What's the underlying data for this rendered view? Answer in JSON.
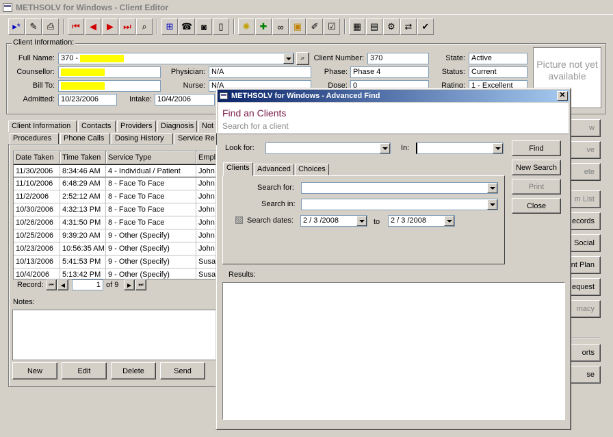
{
  "window": {
    "title": "METHSOLV for Windows - Client Editor"
  },
  "toolbar": {
    "icons": [
      "new-record-icon",
      "edit-icon",
      "print-icon",
      "first-record-icon",
      "previous-record-icon",
      "next-record-icon",
      "last-record-icon",
      "find-icon",
      "add-icon",
      "phone-icon",
      "camera-icon",
      "document-icon",
      "star-icon",
      "add-green-icon",
      "glasses-icon",
      "certificate-icon",
      "note-icon",
      "checklist-icon",
      "calendar-icon",
      "card-icon",
      "settings-icon",
      "transfer-icon",
      "user-check-icon"
    ]
  },
  "client_info": {
    "legend": "Client Information:",
    "full_name_label": "Full Name:",
    "full_name_value": "370 -",
    "counsellor_label": "Counsellor:",
    "bill_to_label": "Bill To:",
    "admitted_label": "Admitted:",
    "admitted_value": "10/23/2006",
    "intake_label": "Intake:",
    "intake_value": "10/4/2006",
    "physician_label": "Physician:",
    "physician_value": "N/A",
    "nurse_label": "Nurse:",
    "nurse_value": "N/A",
    "client_number_label": "Client Number:",
    "client_number_value": "370",
    "phase_label": "Phase:",
    "phase_value": "Phase 4",
    "dose_label": "Dose:",
    "dose_value": "0",
    "state_label": "State:",
    "state_value": "Active",
    "status_label": "Status:",
    "status_value": "Current",
    "rating_label": "Rating:",
    "rating_value": "1 - Excellent",
    "picture_text": "Picture not yet available"
  },
  "tabs_row1": [
    "Client Information",
    "Contacts",
    "Providers",
    "Diagnosis",
    "Not"
  ],
  "tabs_row2": [
    "Procedures",
    "Phone Calls",
    "Dosing History",
    "Service Re"
  ],
  "table": {
    "headers": [
      "Date Taken",
      "Time Taken",
      "Service Type",
      "Empl"
    ],
    "rows": [
      [
        "11/30/2006",
        "8:34:46 AM",
        "4 - Individual / Patient",
        "John"
      ],
      [
        "11/10/2006",
        "6:48:29 AM",
        "8 - Face To Face",
        "John"
      ],
      [
        "11/2/2006",
        "2:52:12 AM",
        "8 - Face To Face",
        "John"
      ],
      [
        "10/30/2006",
        "4:32:13 PM",
        "8 - Face To Face",
        "John"
      ],
      [
        "10/26/2006",
        "4:31:50 PM",
        "8 - Face To Face",
        "John"
      ],
      [
        "10/25/2006",
        "9:39:20 AM",
        "9 - Other  (Specify)",
        "John"
      ],
      [
        "10/23/2006",
        "10:56:35 AM",
        "9 - Other  (Specify)",
        "John"
      ],
      [
        "10/13/2006",
        "5:41:53 PM",
        "9 - Other  (Specify)",
        "Susa"
      ],
      [
        "10/4/2006",
        "5:13:42 PM",
        "9 - Other  (Specify)",
        "Susa"
      ]
    ]
  },
  "record_nav": {
    "label": "Record:",
    "current": "1",
    "of_text": "of 9"
  },
  "notes": {
    "label": "Notes:"
  },
  "bottom_buttons": [
    "New",
    "Edit",
    "Delete",
    "Send"
  ],
  "right_buttons": [
    "w",
    "ve",
    "ete",
    "m List",
    "Records",
    "Social",
    "nt Plan",
    "equest",
    "macy",
    "orts",
    "se"
  ],
  "dialog": {
    "title": "METHSOLV for Windows - Advanced Find",
    "heading": "Find an Clients",
    "subheading": "Search for a client",
    "look_for_label": "Look for:",
    "in_label": "In:",
    "tabs": [
      "Clients",
      "Advanced",
      "Choices"
    ],
    "search_for_label": "Search for:",
    "search_in_label": "Search in:",
    "search_dates_label": "Search dates:",
    "date_from": "2 / 3 /2008",
    "to_label": "to",
    "date_to": "2 / 3 /2008",
    "buttons": {
      "find": "Find",
      "new_search": "New Search",
      "print": "Print",
      "close": "Close"
    },
    "results_label": "Results:"
  },
  "colors": {
    "highlight": "#ffff00",
    "dialog_heading": "#7a1a4a",
    "title_gradient_start": "#0a246a"
  }
}
